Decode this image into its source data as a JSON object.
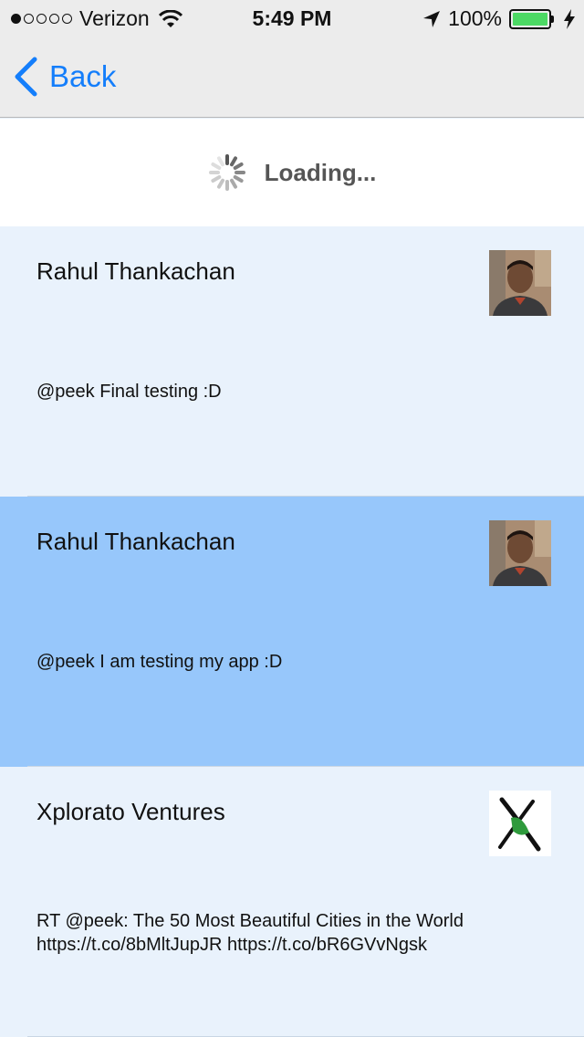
{
  "status_bar": {
    "signal_filled": 1,
    "signal_total": 5,
    "carrier": "Verizon",
    "time": "5:49 PM",
    "battery": "100%"
  },
  "nav": {
    "back_label": "Back"
  },
  "loading": {
    "text": "Loading..."
  },
  "tweets": [
    {
      "name": "Rahul Thankachan",
      "text": "@peek Final testing :D",
      "selected": false
    },
    {
      "name": "Rahul Thankachan",
      "text": "@peek I am testing my app :D",
      "selected": true
    },
    {
      "name": "Xplorato Ventures",
      "text": "RT @peek: The 50 Most Beautiful Cities in the World https://t.co/8bMltJupJR https://t.co/bR6GVvNgsk",
      "selected": false
    }
  ],
  "colors": {
    "accent": "#147efb",
    "cell_background": "#e9f2fc",
    "cell_selected": "#97c7fb",
    "battery": "#4cd964"
  }
}
